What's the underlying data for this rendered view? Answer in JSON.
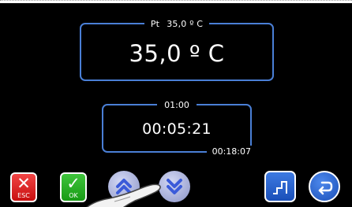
{
  "temperature": {
    "header_label": "Pt",
    "header_setpoint": "35,0 º C",
    "current_value": "35,0 º C"
  },
  "timer": {
    "header_value": "01:00",
    "elapsed": "00:05:21",
    "total": "00:18:07"
  },
  "buttons": {
    "esc_label": "ESC",
    "ok_label": "OK"
  },
  "colors": {
    "panel_border": "#4a7fd6",
    "esc": "#e02020",
    "ok": "#2db52a",
    "arrows": "#3b5bd9",
    "nav": "#2a62cf"
  },
  "icons": {
    "esc": "x-mark-icon",
    "ok": "check-mark-icon",
    "up": "up-arrow-icon",
    "down": "down-arrow-icon",
    "steps": "steps-icon",
    "back": "return-arrow-icon"
  }
}
